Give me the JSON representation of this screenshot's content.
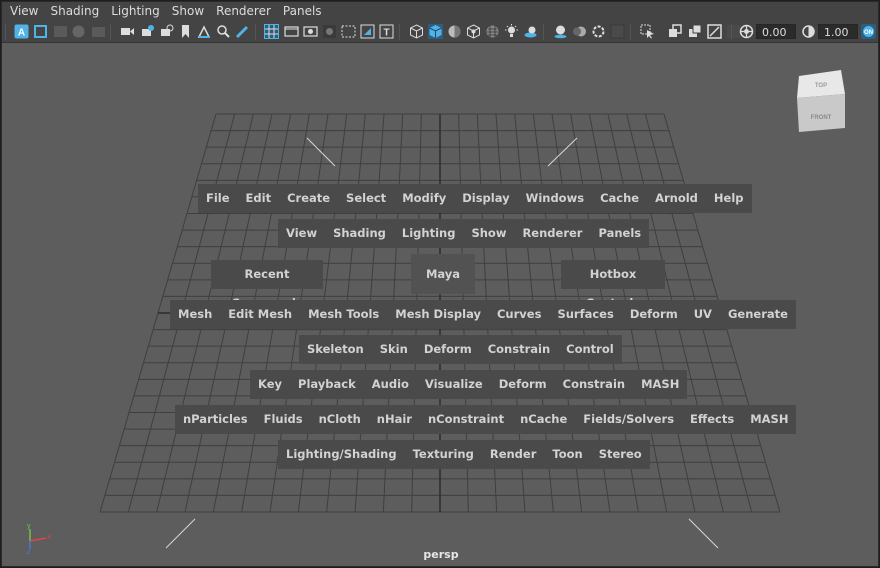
{
  "menubar": {
    "items": [
      "View",
      "Shading",
      "Lighting",
      "Show",
      "Renderer",
      "Panels"
    ]
  },
  "toolbar": {
    "icons": [
      "select-camera-icon",
      "camera-attributes-icon",
      "bookmarks-icon",
      "image-plane-icon",
      "2d-pan-zoom-icon",
      "grease-pencil-icon",
      "camera-icon",
      "snap-camera-icon",
      "camera-sequencer-icon",
      "bookmark-icon",
      "pivot-icon",
      "fov-icon",
      "pencil-icon",
      "grid-icon",
      "film-gate-icon",
      "resolution-gate-icon",
      "gate-mask-icon",
      "field-chart-icon",
      "safe-action-icon",
      "safe-title-icon",
      "wireframe-icon",
      "smooth-shade-icon",
      "wireframe-on-shaded-icon",
      "default-material-icon",
      "textured-icon",
      "use-all-lights-icon",
      "shadows-icon",
      "screen-space-ao-icon",
      "motion-blur-icon",
      "antialiasing-icon",
      "depth-of-field-icon",
      "isolate-select-icon",
      "xray-icon",
      "xray-active-components-icon",
      "xray-joints-icon",
      "backface-icon",
      "exposure-icon",
      "gamma-icon",
      "color-management-icon"
    ],
    "exposure_value": "0.00",
    "gamma_value": "1.00"
  },
  "hotbox": {
    "row1": [
      "File",
      "Edit",
      "Create",
      "Select",
      "Modify",
      "Display",
      "Windows",
      "Cache",
      "Arnold",
      "Help"
    ],
    "row2": [
      "View",
      "Shading",
      "Lighting",
      "Show",
      "Renderer",
      "Panels"
    ],
    "recent_commands": "Recent Commands",
    "center": "Maya",
    "hotbox_controls": "Hotbox Controls",
    "row4": [
      "Mesh",
      "Edit Mesh",
      "Mesh Tools",
      "Mesh Display",
      "Curves",
      "Surfaces",
      "Deform",
      "UV",
      "Generate"
    ],
    "row5": [
      "Skeleton",
      "Skin",
      "Deform",
      "Constrain",
      "Control"
    ],
    "row6": [
      "Key",
      "Playback",
      "Audio",
      "Visualize",
      "Deform",
      "Constrain",
      "MASH"
    ],
    "row7": [
      "nParticles",
      "Fluids",
      "nCloth",
      "nHair",
      "nConstraint",
      "nCache",
      "Fields/Solvers",
      "Effects",
      "MASH"
    ],
    "row8": [
      "Lighting/Shading",
      "Texturing",
      "Render",
      "Toon",
      "Stereo"
    ]
  },
  "viewcube": {
    "top": "TOP",
    "front": "FRONT"
  },
  "viewport": {
    "camera_label": "persp"
  },
  "axis": {
    "x": "x",
    "y": "y",
    "z": "z"
  },
  "colors": {
    "accent_blue": "#4fb3e8",
    "background": "#5d5d5d",
    "grid": "#3f3f3f",
    "hotbox_bg": "#4a4a4a"
  }
}
